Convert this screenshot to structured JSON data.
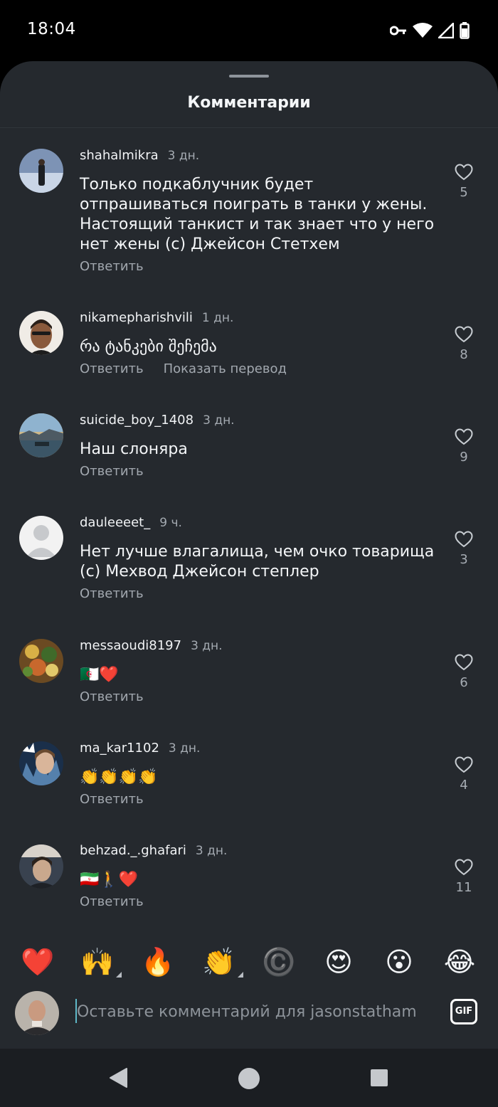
{
  "status_bar": {
    "time": "18:04",
    "icons": [
      "key-icon",
      "wifi-icon",
      "signal-icon",
      "battery-icon"
    ]
  },
  "sheet": {
    "title": "Комментарии"
  },
  "comments": [
    {
      "username": "shahalmikra",
      "time": "3 дн.",
      "text": "Только подкаблучник будет отпрашиваться поиграть в танки у жены. Настоящий танкист и так знает что у него нет жены (с) Джейсон Стетхем",
      "reply_label": "Ответить",
      "likes": "5"
    },
    {
      "username": "nikamepharishvili",
      "time": "1 дн.",
      "text": "რა ტანკები შეჩემა",
      "reply_label": "Ответить",
      "translate_label": "Показать перевод",
      "likes": "8"
    },
    {
      "username": "suicide_boy_1408",
      "time": "3 дн.",
      "text": "Наш слоняра",
      "reply_label": "Ответить",
      "likes": "9"
    },
    {
      "username": "dauleeeet_",
      "time": "9 ч.",
      "text": "Нет лучше влагалища, чем очко товарища (с) Мехвод Джейсон степлер",
      "reply_label": "Ответить",
      "likes": "3"
    },
    {
      "username": "messaoudi8197",
      "time": "3 дн.",
      "text": "🇩🇿❤️",
      "reply_label": "Ответить",
      "likes": "6"
    },
    {
      "username": "ma_kar1102",
      "time": "3 дн.",
      "text": "👏👏👏👏",
      "reply_label": "Ответить",
      "likes": "4"
    },
    {
      "username": "behzad._.ghafari",
      "time": "3 дн.",
      "text": "🇮🇷🚶❤️",
      "reply_label": "Ответить",
      "likes": "11"
    }
  ],
  "emoji_bar": [
    "❤️",
    "🙌",
    "🔥",
    "👏",
    "©️",
    "😍",
    "😮",
    "😂"
  ],
  "composer": {
    "placeholder": "Оставьте комментарий для jasonstatham…",
    "gif_label": "GIF"
  },
  "nav": [
    "back-icon",
    "home-icon",
    "recents-icon"
  ]
}
